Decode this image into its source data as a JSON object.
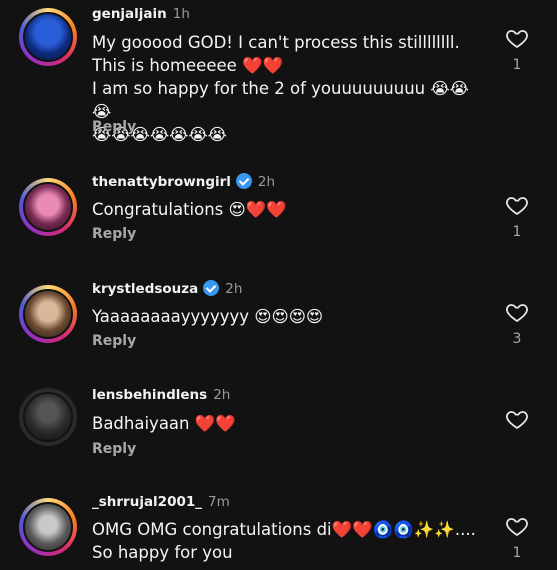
{
  "comments": [
    {
      "username": "genjaljain",
      "time": "1h",
      "verified": false,
      "text": "My gooood GOD! I can't process this stillllllll. This is homeeeee ❤️❤️\nI am so happy for the 2 of youuuuuuuuu 😭😭😭\n😭😭😭😭😭😭😭",
      "reply": "Reply",
      "likes": "1"
    },
    {
      "username": "thenattybrowngirl",
      "time": "2h",
      "verified": true,
      "text": "Congratulations 😍❤️❤️",
      "reply": "Reply",
      "likes": "1"
    },
    {
      "username": "krystledsouza",
      "time": "2h",
      "verified": true,
      "text": "Yaaaaaaaayyyyyyy 😍😍😍😍",
      "reply": "Reply",
      "likes": "3"
    },
    {
      "username": "lensbehindlens",
      "time": "2h",
      "verified": false,
      "text": "Badhaiyaan ❤️❤️",
      "reply": "Reply",
      "likes": ""
    },
    {
      "username": "_shrrujal2001_",
      "time": "7m",
      "verified": false,
      "text": "OMG OMG congratulations di❤️❤️🧿🧿✨✨....\nSo happy for you",
      "reply": "",
      "likes": "1"
    }
  ],
  "icons": {
    "like": "heart-outline-icon",
    "verified": "verified-badge-icon"
  },
  "colors": {
    "background": "#121212",
    "verified": "#3897f0",
    "muted": "#a8a8a8"
  }
}
